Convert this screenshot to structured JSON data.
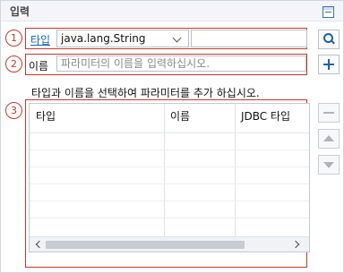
{
  "header": {
    "title": "입력"
  },
  "badges": [
    "1",
    "2",
    "3"
  ],
  "type_row": {
    "link_label": "타입",
    "selected_type": "java.lang.String"
  },
  "name_row": {
    "label": "이름",
    "placeholder": "파라미터의 이름을 입력하십시오."
  },
  "hint": "타입과 이름을 선택하여 파라미터를 추가 하십시오.",
  "table": {
    "columns": [
      "타입",
      "이름",
      "JDBC 타입"
    ],
    "rows": []
  },
  "colors": {
    "badge_red": "#c0392b",
    "accent_blue": "#1f5fa8",
    "link_blue": "#1a5fb4"
  },
  "icons": {
    "collapse": "collapse-icon",
    "search": "search-icon",
    "add": "plus-icon",
    "remove": "minus-icon",
    "up": "triangle-up-icon",
    "down": "triangle-down-icon"
  }
}
